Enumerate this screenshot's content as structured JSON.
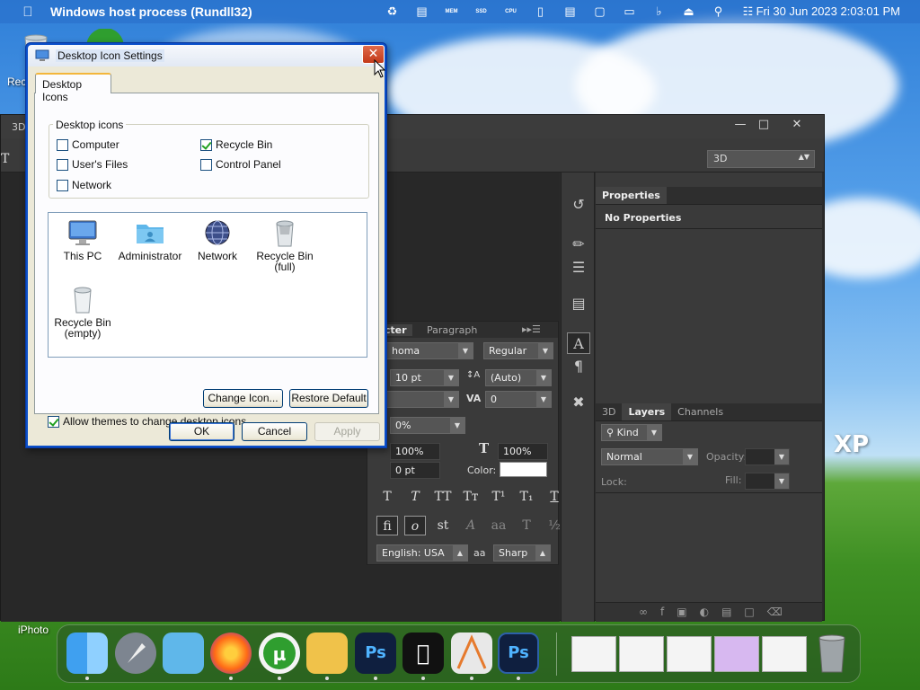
{
  "menubar": {
    "app_title": "Windows host process (Rundll32)",
    "status_icons": [
      "spiral-icon",
      "clipboard-icon",
      "memory-icon",
      "disk-icon",
      "cpu-icon",
      "usb-icon",
      "sidebar-icon",
      "bag-icon",
      "display-icon",
      "mute-icon",
      "eject-icon",
      "search-icon",
      "control-center-icon"
    ],
    "status_labels": [
      "MEM",
      "SSD",
      "CPU"
    ],
    "clock": "Fri 30 Jun 2023  2:03:01 PM"
  },
  "desktop": {
    "partial_label": "Rec",
    "wallpaper_logo": "XP"
  },
  "dialog": {
    "title": "Desktop Icon Settings",
    "close_glyph": "✕",
    "tab_label": "Desktop Icons",
    "group_label": "Desktop icons",
    "checkboxes": [
      {
        "label": "Computer",
        "checked": false
      },
      {
        "label": "User's Files",
        "checked": false
      },
      {
        "label": "Network",
        "checked": false
      },
      {
        "label": "Recycle Bin",
        "checked": true
      },
      {
        "label": "Control Panel",
        "checked": false
      }
    ],
    "icons": [
      {
        "label": "This PC",
        "sub": "",
        "icon": "monitor-icon"
      },
      {
        "label": "Administrator",
        "sub": "",
        "icon": "user-folder-icon"
      },
      {
        "label": "Network",
        "sub": "",
        "icon": "network-globe-icon"
      },
      {
        "label": "Recycle Bin",
        "sub": "(full)",
        "icon": "recycle-bin-full-icon"
      },
      {
        "label": "Recycle Bin",
        "sub": "(empty)",
        "icon": "recycle-bin-empty-icon"
      }
    ],
    "change_icon_label": "Change Icon...",
    "restore_default_label": "Restore Default",
    "allow_themes_label": "Allow themes to change desktop icons",
    "allow_themes_checked": true,
    "ok_label": "OK",
    "cancel_label": "Cancel",
    "apply_label": "Apply"
  },
  "photoshop": {
    "title_partial": "3D",
    "workspace_select": "3D",
    "properties_tab": "Properties",
    "no_properties": "No Properties",
    "layer_tabs": [
      "3D",
      "Layers",
      "Channels"
    ],
    "kind_label": "Kind",
    "blend_mode": "Normal",
    "opacity_label": "Opacity:",
    "lock_label": "Lock:",
    "fill_label": "Fill:",
    "char_tabs": [
      "racter",
      "Paragraph"
    ],
    "font_family": "homa",
    "font_style": "Regular",
    "font_size": "10 pt",
    "leading": "(Auto)",
    "kerning": "0",
    "tracking": "0%",
    "vert_scale": "100%",
    "horiz_scale": "100%",
    "baseline": "0 pt",
    "color_label": "Color:",
    "language": "English: USA",
    "antialias": "Sharp",
    "tracking_icon_label": "VA",
    "aa_icon_label": "aa"
  },
  "dock": {
    "label": "iPhoto",
    "apps": [
      "finder-icon",
      "launchpad-icon",
      "folder-icon",
      "firefox-icon",
      "utorrent-icon",
      "file-manager-icon",
      "photoshop-icon",
      "apple-logo-icon",
      "instruments-icon",
      "photoshop-alt-icon"
    ],
    "ps_short": "Ps"
  }
}
